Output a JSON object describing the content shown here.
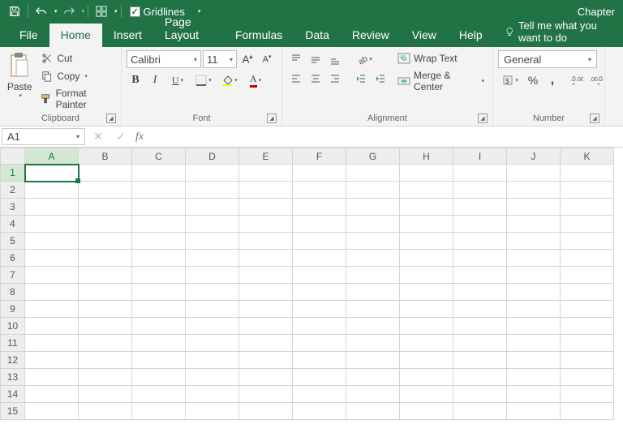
{
  "title_bar": {
    "gridlines_label": "Gridlines",
    "doc_title": "Chapter"
  },
  "tabs": {
    "file": "File",
    "home": "Home",
    "insert": "Insert",
    "page_layout": "Page Layout",
    "formulas": "Formulas",
    "data": "Data",
    "review": "Review",
    "view": "View",
    "help": "Help",
    "tell_me": "Tell me what you want to do"
  },
  "clipboard": {
    "paste": "Paste",
    "cut": "Cut",
    "copy": "Copy",
    "format_painter": "Format Painter",
    "group_label": "Clipboard"
  },
  "font": {
    "name": "Calibri",
    "size": "11",
    "group_label": "Font"
  },
  "alignment": {
    "wrap_text": "Wrap Text",
    "merge_center": "Merge & Center",
    "group_label": "Alignment"
  },
  "number": {
    "format": "General",
    "group_label": "Number"
  },
  "formula_bar": {
    "name_box": "A1",
    "fx": "fx",
    "value": ""
  },
  "grid": {
    "columns": [
      "A",
      "B",
      "C",
      "D",
      "E",
      "F",
      "G",
      "H",
      "I",
      "J",
      "K"
    ],
    "rows": [
      "1",
      "2",
      "3",
      "4",
      "5",
      "6",
      "7",
      "8",
      "9",
      "10",
      "11",
      "12",
      "13",
      "14",
      "15"
    ],
    "selected_col": "A",
    "selected_row": "1"
  }
}
